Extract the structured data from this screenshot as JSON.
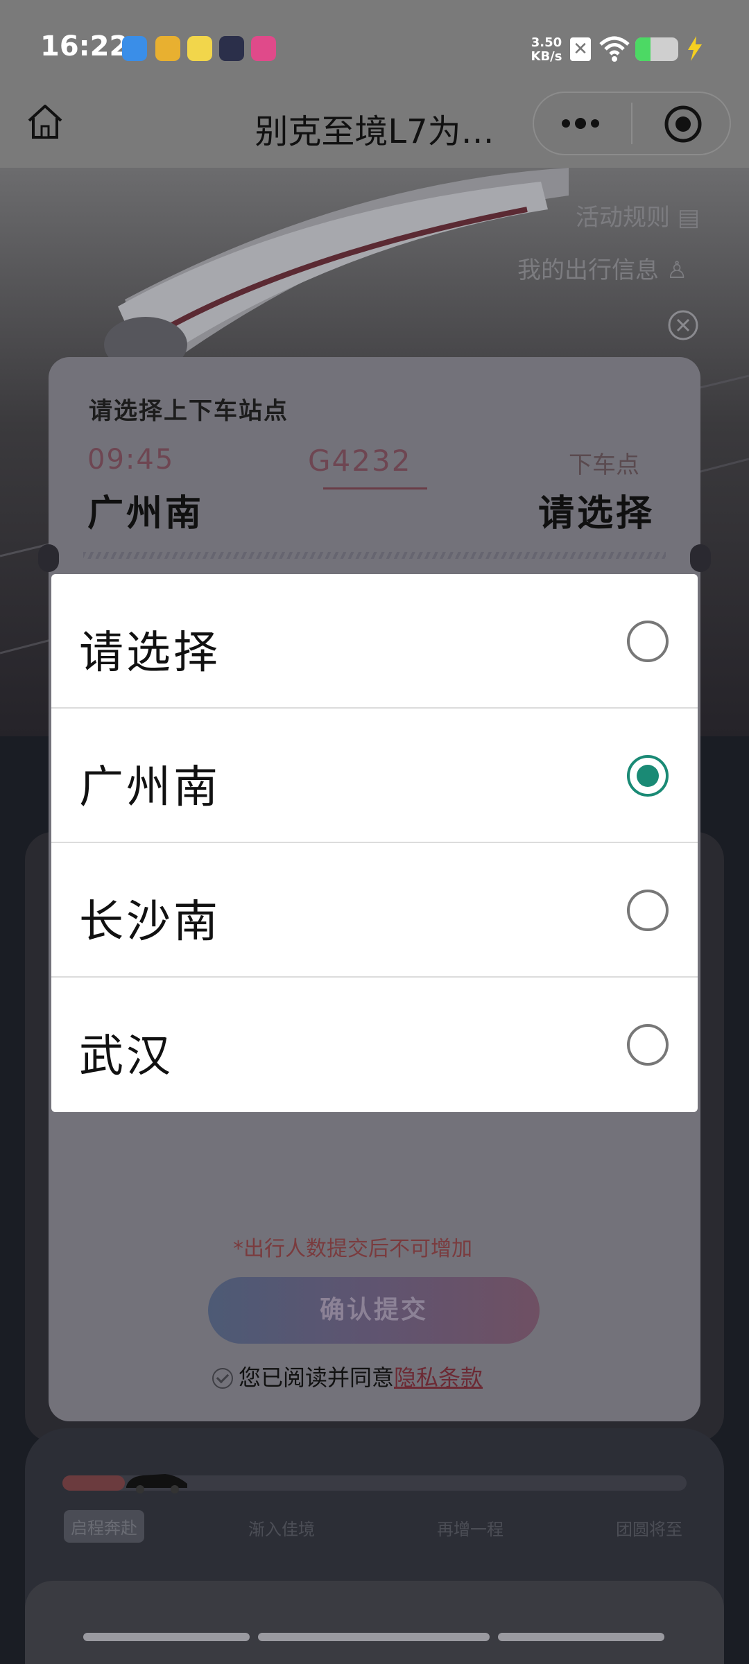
{
  "status_bar": {
    "time": "16:22",
    "net_speed_value": "3.50",
    "net_speed_unit": "KB/s"
  },
  "nav": {
    "title": "别克至境L7为…"
  },
  "hero": {
    "rules_label": "活动规则",
    "trip_info_label": "我的出行信息"
  },
  "station_card": {
    "title": "请选择上下车站点",
    "departure_time": "09:45",
    "train_no": "G4232",
    "arrival_label": "下车点",
    "departure_station": "广州南",
    "arrival_station": "请选择",
    "warning": "*出行人数提交后不可增加",
    "confirm_label": "确认提交",
    "agree_text": "您已阅读并同意",
    "privacy_link": "隐私条款"
  },
  "picker": {
    "options": [
      {
        "label": "请选择",
        "selected": false
      },
      {
        "label": "广州南",
        "selected": true
      },
      {
        "label": "长沙南",
        "selected": false
      },
      {
        "label": "武汉",
        "selected": false
      }
    ],
    "accent_color": "#1a8a75"
  },
  "progress": {
    "stages": [
      "启程奔赴",
      "渐入佳境",
      "再增一程",
      "团圆将至"
    ],
    "active_stage": 0
  }
}
